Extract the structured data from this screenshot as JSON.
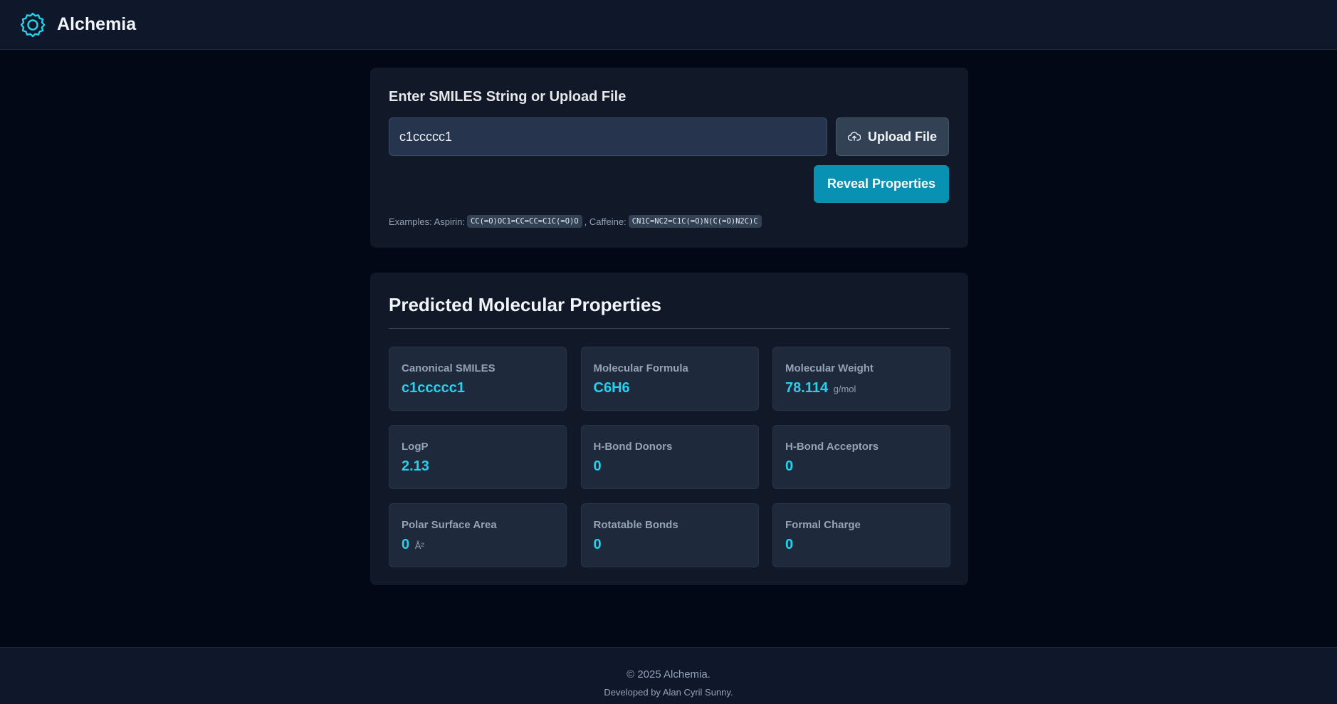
{
  "header": {
    "logo_icon": "gear-icon",
    "app_name": "Alchemia",
    "accent_color": "#22d3ee"
  },
  "input_panel": {
    "label": "Enter SMILES String or Upload File",
    "smiles_value": "c1ccccc1",
    "upload_icon": "cloud-upload-icon",
    "upload_label": "Upload File",
    "reveal_label": "Reveal Properties",
    "examples_prefix": "Examples: Aspirin:",
    "aspirin_smiles": "CC(=O)OC1=CC=CC=C1C(=O)O",
    "caffeine_prefix": ", Caffeine:",
    "caffeine_smiles": "CN1C=NC2=C1C(=O)N(C(=O)N2C)C"
  },
  "results": {
    "title": "Predicted Molecular Properties",
    "cards": [
      {
        "label": "Canonical SMILES",
        "value": "c1ccccc1",
        "unit": ""
      },
      {
        "label": "Molecular Formula",
        "value": "C6H6",
        "unit": ""
      },
      {
        "label": "Molecular Weight",
        "value": "78.114",
        "unit": "g/mol"
      },
      {
        "label": "LogP",
        "value": "2.13",
        "unit": ""
      },
      {
        "label": "H-Bond Donors",
        "value": "0",
        "unit": ""
      },
      {
        "label": "H-Bond Acceptors",
        "value": "0",
        "unit": ""
      },
      {
        "label": "Polar Surface Area",
        "value": "0",
        "unit": "Å²"
      },
      {
        "label": "Rotatable Bonds",
        "value": "0",
        "unit": ""
      },
      {
        "label": "Formal Charge",
        "value": "0",
        "unit": ""
      }
    ]
  },
  "footer": {
    "copyright": "© 2025 Alchemia.",
    "developer": "Developed by Alan Cyril Sunny."
  }
}
